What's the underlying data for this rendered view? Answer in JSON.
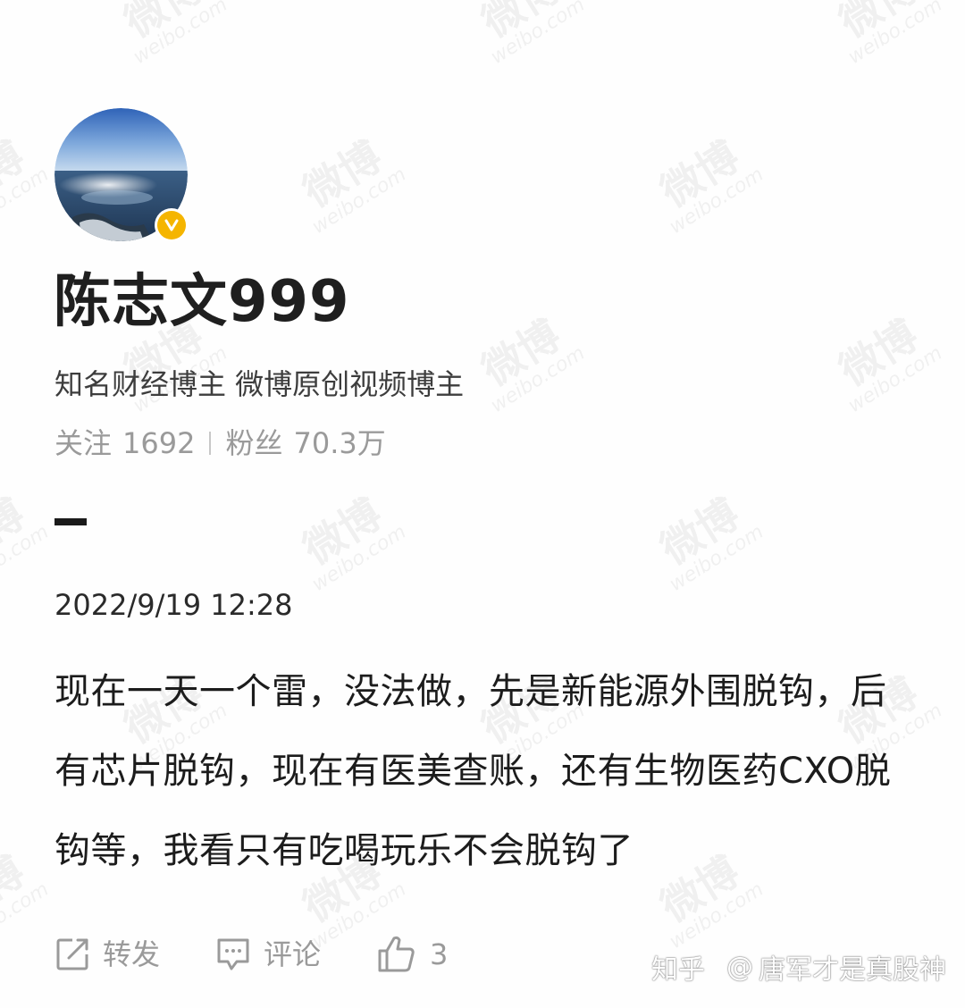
{
  "profile": {
    "username": "陈志文999",
    "bio": "知名财经博主 微博原创视频博主",
    "following_label": "关注",
    "following_count": "1692",
    "followers_label": "粉丝",
    "followers_count": "70.3万",
    "verified_icon": "verified-badge-icon"
  },
  "post": {
    "timestamp": "2022/9/19 12:28",
    "text": "现在一天一个雷，没法做，先是新能源外围脱钩，后有芯片脱钩，现在有医美查账，还有生物医药CXO脱钩等，我看只有吃喝玩乐不会脱钩了"
  },
  "actions": {
    "repost_label": "转发",
    "comment_label": "评论",
    "like_count": "3"
  },
  "watermark": {
    "site_cn": "微博",
    "site_en": "weibo.com",
    "zhihu_label": "知乎",
    "zhihu_at": "@",
    "zhihu_user": "唐军才是真股神"
  },
  "colors": {
    "verified_gold": "#f5b500",
    "muted_gray": "#9a9a9a",
    "text_dark": "#1c1c1c"
  }
}
